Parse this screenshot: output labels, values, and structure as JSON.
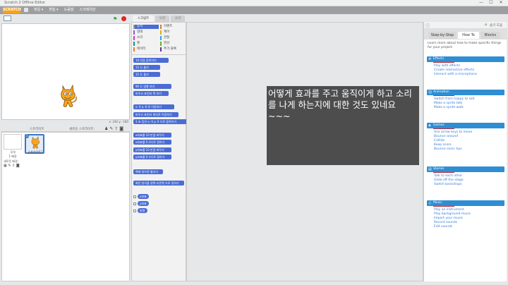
{
  "window": {
    "title": "Scratch 2 Offline Editor",
    "buttons": [
      "—",
      "☐",
      "✕"
    ]
  },
  "menubar": {
    "logo": "SCRATCH",
    "items": [
      "파일 ▾",
      "편집 ▾",
      "도움말",
      "스크래치란"
    ]
  },
  "stage": {
    "coords": "x: 240  y: -180"
  },
  "sprites": {
    "header_label": "스프라이트",
    "new_label": "새로운 스프라이트:",
    "stage_label": "무대",
    "stage_sub": "1 배경",
    "new_backdrop_label": "새로운 배경:",
    "sprite_name": "스프라이트1",
    "sprite_index": "1"
  },
  "tabs": [
    "스크립트",
    "모양",
    "소리"
  ],
  "categories": [
    {
      "label": "동작",
      "color": "#4a6cd4"
    },
    {
      "label": "형태",
      "color": "#8a55d7"
    },
    {
      "label": "소리",
      "color": "#bb42c3"
    },
    {
      "label": "펜",
      "color": "#0e9a6c"
    },
    {
      "label": "데이터",
      "color": "#ee7d16"
    },
    {
      "label": "이벤트",
      "color": "#c88330"
    },
    {
      "label": "제어",
      "color": "#e1a91a"
    },
    {
      "label": "관찰",
      "color": "#2ca5e2"
    },
    {
      "label": "연산",
      "color": "#5cb712"
    },
    {
      "label": "추가 블록",
      "color": "#632d99"
    }
  ],
  "blocks": [
    "10 만큼 움직이기",
    "15 도 돌기",
    "15 도 돌기",
    "90 도 방향 보기",
    "마우스 포인터 쪽 보기",
    "x: 0 y: 0 로 이동하기",
    "마우스 포인터 위치로 이동하기",
    "1 초 동안 x: 0 y: 0 으로 움직이기",
    "x좌표를 10 만큼 바꾸기",
    "x좌표를 0 (으)로 정하기",
    "y좌표를 10 만큼 바꾸기",
    "y좌표를 0 (으)로 정하기",
    "벽에 닿으면 튕기기",
    "회전 방식을 왼쪽-오른쪽 으로 정하기",
    "x좌표",
    "y좌표",
    "방향"
  ],
  "overlay_text": "어떻게 효과를 주고 움직이게 하고 소리를 나게 하는지에 대한 것도 있네요~~~",
  "tips": {
    "hide_label": "숨기 도움",
    "tabs": [
      "Step-by-Step",
      "How To",
      "Blocks"
    ],
    "intro": "Learn more about how to make specific things for your project.",
    "sections": [
      {
        "title": "Effects",
        "links": [
          "Play with effects",
          "Create interactive effects",
          "Interact with a microphone"
        ]
      },
      {
        "title": "Animation",
        "links": [
          "Switch from happy to sad",
          "Make a sprite talk",
          "Make a sprite walk"
        ]
      },
      {
        "title": "Games",
        "links": [
          "Use arrow keys to move",
          "Bounce around",
          "Collide",
          "Keep score",
          "Bounce sonic tips"
        ]
      },
      {
        "title": "Stories",
        "links": [
          "Talk to each other",
          "Glide off the stage",
          "Switch backdrops"
        ]
      },
      {
        "title": "Music",
        "links": [
          "Play an instrument",
          "Play background music",
          "Import your music",
          "Record sounds",
          "Edit sounds"
        ]
      }
    ]
  },
  "colors": {
    "accent": "#4a6cd4",
    "tip_head": "#2f8ed3",
    "menubar": "#9c9ea1"
  }
}
